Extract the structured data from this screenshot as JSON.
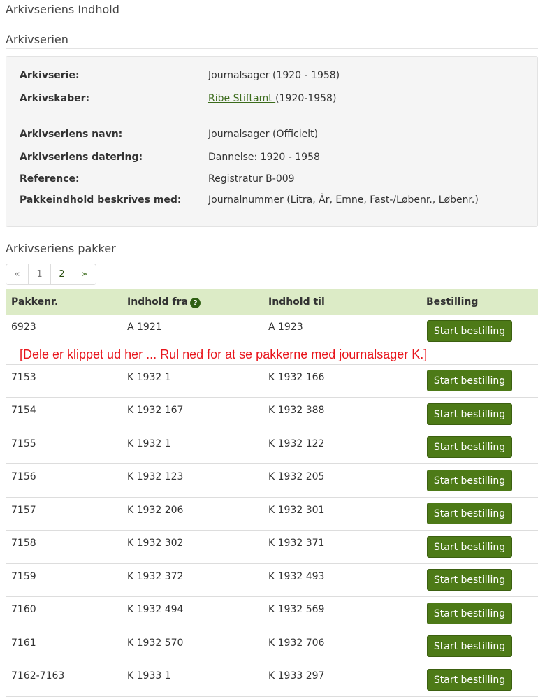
{
  "page_title": "Arkivseriens Indhold",
  "series_section": {
    "title": "Arkivserien",
    "rows": [
      {
        "label": "Arkivserie:",
        "value": "Journalsager (1920 - 1958)"
      },
      {
        "label": "Arkivskaber:",
        "link": "Ribe Stiftamt ",
        "value": "(1920-1958)"
      },
      {
        "label": "Arkivseriens navn:",
        "value": "Journalsager (Officielt)"
      },
      {
        "label": "Arkivseriens datering:",
        "value": "Dannelse: 1920 - 1958"
      },
      {
        "label": "Reference:",
        "value": "Registratur B-009"
      },
      {
        "label": "Pakkeindhold beskrives med:",
        "value": "Journalnummer (Litra, År, Emne, Fast-/Løbenr., Løbenr.)"
      }
    ]
  },
  "packages_section": {
    "title": "Arkivseriens pakker",
    "pagination": {
      "prev": "«",
      "pages": [
        "1",
        "2"
      ],
      "next": "»",
      "active": "2"
    },
    "columns": {
      "pakkenr": "Pakkenr.",
      "fra": "Indhold fra",
      "til": "Indhold til",
      "bestilling": "Bestilling"
    },
    "order_button_label": "Start bestilling",
    "rows": [
      {
        "pakkenr": "6923",
        "fra": "A 1921",
        "til": "A 1923"
      },
      {
        "pakkenr": "7153",
        "fra": "K 1932 1",
        "til": "K 1932 166"
      },
      {
        "pakkenr": "7154",
        "fra": "K 1932 167",
        "til": "K 1932 388"
      },
      {
        "pakkenr": "7155",
        "fra": "K 1932 1",
        "til": "K 1932 122"
      },
      {
        "pakkenr": "7156",
        "fra": "K 1932 123",
        "til": "K 1932 205"
      },
      {
        "pakkenr": "7157",
        "fra": "K 1932 206",
        "til": "K 1932 301"
      },
      {
        "pakkenr": "7158",
        "fra": "K 1932 302",
        "til": "K 1932 371"
      },
      {
        "pakkenr": "7159",
        "fra": "K 1932 372",
        "til": "K 1932 493"
      },
      {
        "pakkenr": "7160",
        "fra": "K 1932 494",
        "til": "K 1932 569"
      },
      {
        "pakkenr": "7161",
        "fra": "K 1932 570",
        "til": "K 1932 706"
      },
      {
        "pakkenr": "7162-7163",
        "fra": "K 1933 1",
        "til": "K 1933 297"
      }
    ]
  },
  "clip_note": "[Dele er klippet ud her ... Rul ned for at se pakkerne med journalsager K.]",
  "colors": {
    "accent": "#4d7a17",
    "header_bg": "#dcebc6",
    "note": "#e8141b",
    "link": "#3b6b1b"
  }
}
